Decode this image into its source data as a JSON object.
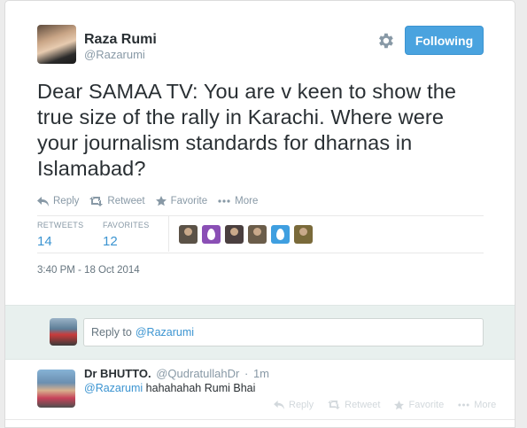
{
  "author": {
    "name": "Raza Rumi",
    "handle": "@Razarumi"
  },
  "follow_button": {
    "label": "Following"
  },
  "tweet": {
    "text": "Dear SAMAA TV: You are v keen to show the true size of the rally in Karachi. Where were your journalism standards for dharnas in Islamabad?",
    "timestamp": "3:40 PM - 18 Oct 2014"
  },
  "actions": {
    "reply": "Reply",
    "retweet": "Retweet",
    "favorite": "Favorite",
    "more": "More"
  },
  "stats": {
    "retweets_label": "RETWEETS",
    "retweets": "14",
    "favorites_label": "FAVORITES",
    "favorites": "12"
  },
  "favoriters": [
    {
      "icon": "user-avatar-photo",
      "bg": "#5b5247"
    },
    {
      "icon": "purple-egg-avatar",
      "bg": "#8a4fb5"
    },
    {
      "icon": "user-avatar-photo",
      "bg": "#4a3f3f"
    },
    {
      "icon": "user-avatar-photo",
      "bg": "#6b5d4a"
    },
    {
      "icon": "blue-egg-avatar",
      "bg": "#3f9fe0"
    },
    {
      "icon": "user-avatar-photo",
      "bg": "#7a6a3a"
    }
  ],
  "reply_box": {
    "prefix": "Reply to",
    "mention": "@Razarumi"
  },
  "reply_tweet": {
    "name": "Dr BHUTTO.",
    "handle": "@QudratullahDr",
    "separator": "·",
    "time": "1m",
    "mention": "@Razarumi",
    "text": "hahahahah Rumi Bhai"
  },
  "colors": {
    "link": "#3b94d1",
    "follow_bg": "#4aa3df",
    "reply_area_bg": "#e8f0ee"
  }
}
